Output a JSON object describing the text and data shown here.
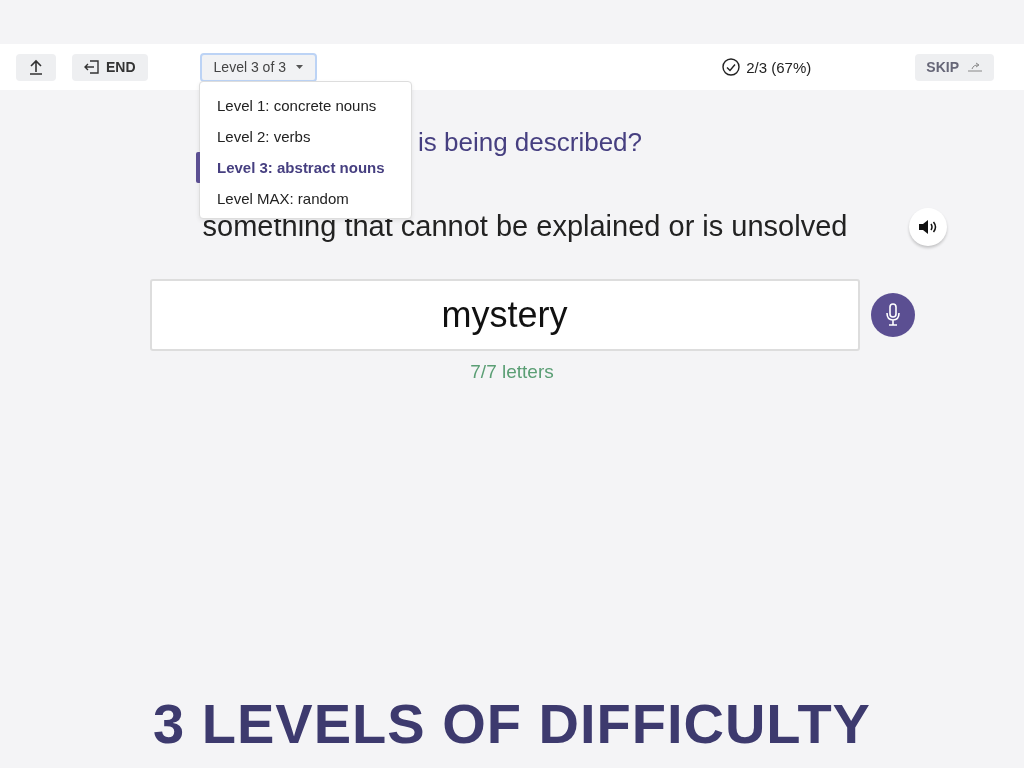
{
  "toolbar": {
    "end_button": "END",
    "level_select": "Level 3 of 3",
    "progress": "2/3 (67%)",
    "skip_button": "SKIP"
  },
  "level_menu": [
    {
      "label": "Level 1: concrete nouns",
      "selected": false
    },
    {
      "label": "Level 2: verbs",
      "selected": false
    },
    {
      "label": "Level 3: abstract nouns",
      "selected": true
    },
    {
      "label": "Level MAX: random",
      "selected": false
    }
  ],
  "question": "is being described?",
  "definition": "something that cannot be explained or is unsolved",
  "answer": {
    "value": "mystery"
  },
  "letter_count": "7/7 letters",
  "headline": "3 LEVELS OF DIFFICULTY"
}
